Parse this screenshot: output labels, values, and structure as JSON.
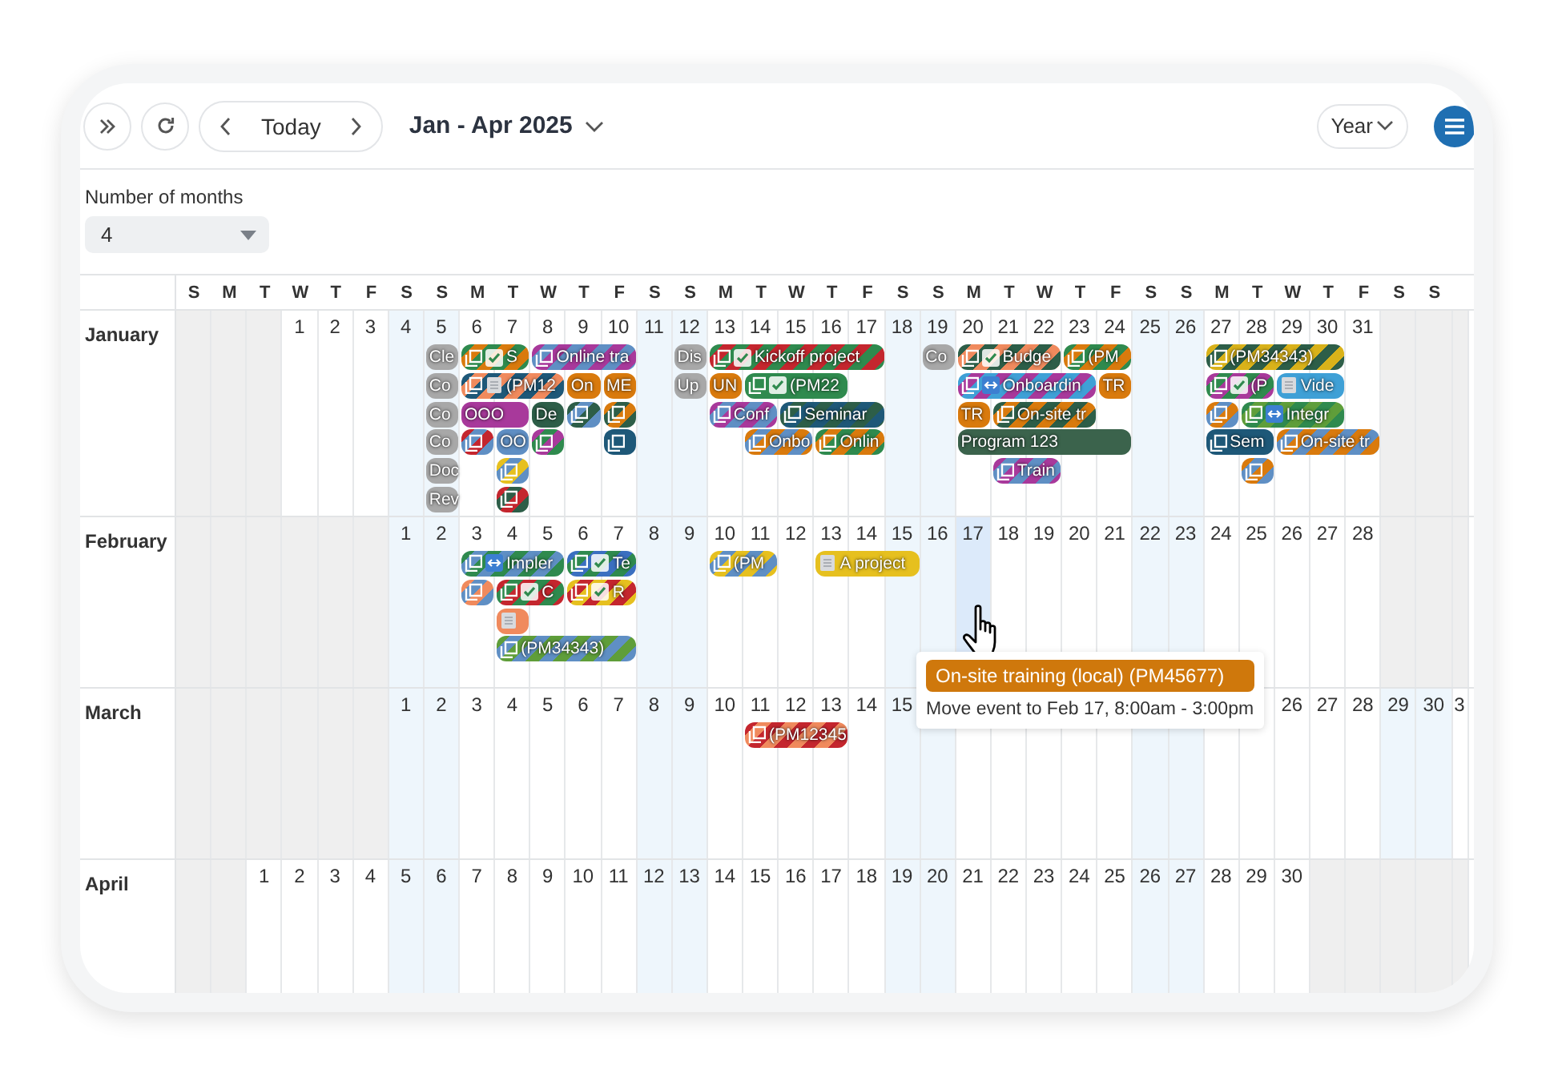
{
  "toolbar": {
    "today": "Today",
    "title": "Jan - Apr 2025",
    "view": "Year"
  },
  "months_setting": {
    "label": "Number of months",
    "value": "4"
  },
  "weekdays": [
    "S",
    "M",
    "T",
    "W",
    "T",
    "F",
    "S",
    "S",
    "M",
    "T",
    "W",
    "T",
    "F",
    "S",
    "S",
    "M",
    "T",
    "W",
    "T",
    "F",
    "S",
    "S",
    "M",
    "T",
    "W",
    "T",
    "F",
    "S",
    "S",
    "M",
    "T",
    "W",
    "T",
    "F",
    "S",
    "S"
  ],
  "months": [
    {
      "name": "January",
      "days": [
        {
          "kind": "blank"
        },
        {
          "kind": "blank"
        },
        {
          "kind": "blank"
        },
        "1",
        "2",
        "3",
        "4",
        {
          "label": "5",
          "events": [
            {
              "text": "Cle",
              "kind": "one-day",
              "color": "#a8a8a8"
            },
            {
              "text": "Co",
              "kind": "one-day",
              "color": "#a8a8a8"
            },
            {
              "text": "Co",
              "kind": "one-day",
              "color": "#a8a8a8"
            },
            {
              "text": "Co",
              "kind": "one-day",
              "color": "#a8a8a8"
            },
            {
              "text": "Doc",
              "kind": "one-day",
              "color": "#a8a8a8"
            },
            {
              "text": "Rev",
              "kind": "one-day",
              "color": "#a8a8a8"
            }
          ]
        },
        {
          "label": "6",
          "events": [
            {
              "text": "S",
              "kind": "two-day",
              "color": "#2f8a4e",
              "stripe": {
                "color": "#d97a0d"
              },
              "copy": true,
              "checked": true
            },
            {
              "text": "(PM12",
              "kind": "three-day",
              "color": "#1e5878",
              "stripe": {
                "color": "#f08a5d"
              },
              "copy": true,
              "note": true
            },
            {
              "text": "OOO",
              "kind": "two-day",
              "color": "#a8399b"
            },
            {
              "kind": "one-day",
              "color": "#c4262e",
              "stripe": {
                "color": "#5f8fc4"
              },
              "copy": true
            }
          ]
        },
        {
          "label": "7",
          "events": [
            {
              "text": "OO",
              "kind": "one-day",
              "color": "#5f8fc4"
            },
            {
              "kind": "one-day",
              "color": "#e6c01f",
              "stripe": {
                "color": "#5f8fc4"
              },
              "copy": true
            },
            {
              "kind": "one-day",
              "color": "#c4262e",
              "stripe": {
                "color": "#2d5e48"
              },
              "copy": true
            }
          ]
        },
        {
          "label": "8",
          "events": [
            {
              "text": "Online tra",
              "kind": "three-day",
              "color": "#a8399b",
              "stripe": {
                "color": "#5f8fc4"
              },
              "copy": true
            },
            {
              "text": "De",
              "kind": "one-day",
              "color": "#2d5e48"
            },
            {
              "kind": "one-day",
              "color": "#a8399b",
              "stripe": {
                "color": "#2f8a4e"
              },
              "copy": true
            }
          ]
        },
        {
          "label": "9",
          "events": [
            {
              "text": "On",
              "kind": "one-day",
              "color": "#d97a0d"
            },
            {
              "kind": "one-day",
              "color": "#2d5e48",
              "stripe": {
                "color": "#5f8fc4"
              },
              "copy": true
            }
          ]
        },
        {
          "label": "10",
          "events": [
            {
              "text": "ME",
              "kind": "one-day",
              "color": "#d97a0d"
            },
            {
              "kind": "one-day",
              "color": "#d97a0d",
              "stripe": {
                "color": "#2d5e48"
              },
              "copy": true
            },
            {
              "kind": "one-day",
              "color": "#1e5878",
              "copy": true
            }
          ]
        },
        "11",
        {
          "label": "12",
          "events": [
            {
              "text": "Dis",
              "kind": "one-day",
              "color": "#a8a8a8"
            },
            {
              "text": "Up",
              "kind": "one-day",
              "color": "#a8a8a8"
            }
          ]
        },
        {
          "label": "13",
          "events": [
            {
              "text": "Kickoff project",
              "kind": "five-day",
              "color": "#2f8a4e",
              "stripe": {
                "color": "#c4262e"
              },
              "copy": true,
              "checked": true
            },
            {
              "text": "UN",
              "kind": "one-day",
              "color": "#d97a0d"
            },
            {
              "text": "Conf",
              "kind": "two-day",
              "color": "#a8399b",
              "stripe": {
                "color": "#5f8fc4"
              },
              "copy": true
            }
          ]
        },
        {
          "label": "14",
          "events": [
            {
              "text": "(PM22",
              "kind": "three-day",
              "color": "#2f8a4e",
              "copy": true,
              "checked": true
            },
            {
              "text": "Onbo",
              "kind": "two-day",
              "color": "#d97a0d",
              "stripe": {
                "color": "#5f8fc4"
              },
              "copy": true
            }
          ]
        },
        {
          "label": "15",
          "events": [
            {
              "text": "Seminar",
              "kind": "three-day",
              "color": "#1e5878",
              "stripe": {
                "color": "#2d5e48"
              },
              "copy": true
            }
          ]
        },
        {
          "label": "16",
          "events": [
            {
              "text": "Onlin",
              "kind": "two-day",
              "color": "#2f8a4e",
              "stripe": {
                "color": "#d97a0d"
              },
              "copy": true
            }
          ]
        },
        "17",
        "18",
        {
          "label": "19",
          "events": [
            {
              "text": "Co",
              "kind": "one-day",
              "color": "#a8a8a8"
            }
          ]
        },
        {
          "label": "20",
          "events": [
            {
              "text": "Budge",
              "kind": "three-day",
              "color": "#2d5e48",
              "stripe": {
                "color": "#f08a5d"
              },
              "copy": true,
              "checked": true
            },
            {
              "text": "Onboardin",
              "kind": "four-day",
              "color": "#3fa0d6",
              "stripe": {
                "color": "#a8399b"
              },
              "copy": true,
              "linked": true
            },
            {
              "text": "TR",
              "kind": "one-day",
              "color": "#d97a0d"
            },
            {
              "text": "Program 123",
              "kind": "five-day",
              "color": "#3b634c"
            }
          ]
        },
        {
          "label": "21",
          "events": [
            {
              "text": "On-site tr",
              "kind": "three-day",
              "color": "#2d5e48",
              "stripe": {
                "color": "#d97a0d"
              },
              "copy": true
            },
            {
              "text": "Train",
              "kind": "two-day",
              "color": "#a8399b",
              "stripe": {
                "color": "#5f8fc4"
              },
              "copy": true
            }
          ]
        },
        "22",
        {
          "label": "23",
          "events": [
            {
              "text": "(PM",
              "kind": "two-day",
              "color": "#2f8a4e",
              "stripe": {
                "color": "#d97a0d"
              },
              "copy": true
            }
          ]
        },
        {
          "label": "24",
          "events": [
            {
              "text": "TR",
              "kind": "one-day",
              "color": "#d97a0d"
            }
          ]
        },
        "25",
        "26",
        {
          "label": "27",
          "events": [
            {
              "text": "(PM34343)",
              "kind": "four-day",
              "color": "#d9b21a",
              "stripe": {
                "color": "#2d5e48"
              },
              "copy": true
            },
            {
              "text": "(P",
              "kind": "two-day",
              "color": "#a8399b",
              "stripe": {
                "color": "#2f8a4e"
              },
              "copy": true,
              "checked": true
            },
            {
              "kind": "one-day",
              "color": "#d97a0d",
              "stripe": {
                "color": "#5f8fc4"
              },
              "copy": true
            },
            {
              "text": "Sem",
              "kind": "two-day",
              "color": "#1e5878",
              "copy": true
            }
          ]
        },
        {
          "label": "28",
          "events": [
            {
              "text": "Integr",
              "kind": "three-day",
              "color": "#2f8a4e",
              "stripe": {
                "color": "#5f9e3a"
              },
              "copy": true,
              "linked": true
            },
            {
              "kind": "one-day",
              "color": "#d97a0d",
              "stripe": {
                "color": "#5f8fc4"
              },
              "copy": true
            }
          ]
        },
        {
          "label": "29",
          "events": [
            {
              "text": "Vide",
              "kind": "two-day",
              "color": "#3fa0d6",
              "note": true
            },
            {
              "text": "On-site tr",
              "kind": "three-day",
              "color": "#d97a0d",
              "stripe": {
                "color": "#5f8fc4"
              },
              "copy": true
            }
          ]
        },
        "30",
        "31",
        {
          "kind": "blank"
        },
        {
          "kind": "blank"
        },
        {
          "kind": "blank"
        }
      ]
    },
    {
      "name": "February",
      "days": [
        {
          "kind": "blank"
        },
        {
          "kind": "blank"
        },
        {
          "kind": "blank"
        },
        {
          "kind": "blank"
        },
        {
          "kind": "blank"
        },
        {
          "kind": "blank"
        },
        "1",
        "2",
        {
          "label": "3",
          "events": [
            {
              "text": "Impler",
              "kind": "three-day",
              "color": "#2f8a4e",
              "stripe": {
                "color": "#5f8fc4"
              },
              "copy": true,
              "linked": true
            },
            {
              "kind": "one-day",
              "color": "#f08a5d",
              "stripe": {
                "color": "#5f8fc4"
              },
              "copy": true
            }
          ]
        },
        {
          "label": "4",
          "events": [
            {
              "text": "C",
              "kind": "two-day",
              "color": "#c4262e",
              "stripe": {
                "color": "#2f8a4e"
              },
              "copy": true,
              "checked": true
            },
            {
              "kind": "one-day",
              "color": "#f08a5d",
              "note": true
            },
            {
              "text": "(PM34343)",
              "kind": "four-day",
              "color": "#5f9e3a",
              "stripe": {
                "color": "#5f8fc4"
              },
              "copy": true
            }
          ]
        },
        "5",
        {
          "label": "6",
          "events": [
            {
              "text": "Te",
              "kind": "two-day",
              "color": "#3b6fc0",
              "stripe": {
                "color": "#2f8a4e"
              },
              "copy": true,
              "checked": true
            },
            {
              "text": "R",
              "kind": "two-day",
              "color": "#e6c01f",
              "stripe": {
                "color": "#c4262e"
              },
              "copy": true,
              "checked": true
            }
          ]
        },
        "7",
        "8",
        "9",
        {
          "label": "10",
          "events": [
            {
              "text": "(PM",
              "kind": "two-day",
              "color": "#e6c01f",
              "stripe": {
                "color": "#5f8fc4"
              },
              "copy": true
            }
          ]
        },
        "11",
        "12",
        {
          "label": "13",
          "events": [
            {
              "text": "A project",
              "kind": "three-day",
              "color": "#e6c01f",
              "note": true
            }
          ]
        },
        "14",
        "15",
        "16",
        {
          "label": "17",
          "drop_target": true
        },
        "18",
        "19",
        "20",
        "21",
        "22",
        "23",
        "24",
        "25",
        "26",
        "27",
        "28",
        {
          "kind": "blank"
        },
        {
          "kind": "blank"
        },
        {
          "kind": "blank"
        }
      ]
    },
    {
      "name": "March",
      "days": [
        {
          "kind": "blank"
        },
        {
          "kind": "blank"
        },
        {
          "kind": "blank"
        },
        {
          "kind": "blank"
        },
        {
          "kind": "blank"
        },
        {
          "kind": "blank"
        },
        "1",
        "2",
        "3",
        "4",
        "5",
        "6",
        "7",
        "8",
        "9",
        "10",
        {
          "label": "11",
          "events": [
            {
              "text": "(PM12345",
              "kind": "three-day",
              "color": "#c4262e",
              "stripe": {
                "color": "#f08a5d"
              },
              "copy": true
            }
          ]
        },
        "12",
        "13",
        "14",
        "15",
        {
          "kind": "covered"
        },
        {
          "kind": "covered"
        },
        {
          "kind": "covered"
        },
        {
          "kind": "covered"
        },
        {
          "kind": "covered"
        },
        {
          "kind": "covered"
        },
        {
          "kind": "covered"
        },
        {
          "kind": "covered"
        },
        {
          "kind": "covered"
        },
        {
          "kind": "covered"
        },
        "26",
        "27",
        "28",
        "29",
        "30",
        "3"
      ]
    },
    {
      "name": "April",
      "days": [
        {
          "kind": "blank"
        },
        {
          "kind": "blank"
        },
        "1",
        "2",
        "3",
        "4",
        "5",
        "6",
        "7",
        "8",
        "9",
        "10",
        "11",
        "12",
        "13",
        "14",
        "15",
        "16",
        "17",
        "18",
        "19",
        "20",
        "21",
        "22",
        "23",
        "24",
        "25",
        "26",
        "27",
        "28",
        "29",
        "30",
        {
          "kind": "blank"
        },
        {
          "kind": "blank"
        },
        {
          "kind": "blank"
        },
        {
          "kind": "blank"
        },
        {
          "kind": "blank"
        }
      ]
    }
  ],
  "tooltip": {
    "title": "On-site training (local) (PM45677)",
    "color": "#cf780c",
    "text": "Move event to Feb 17, 8:00am - 3:00pm"
  }
}
